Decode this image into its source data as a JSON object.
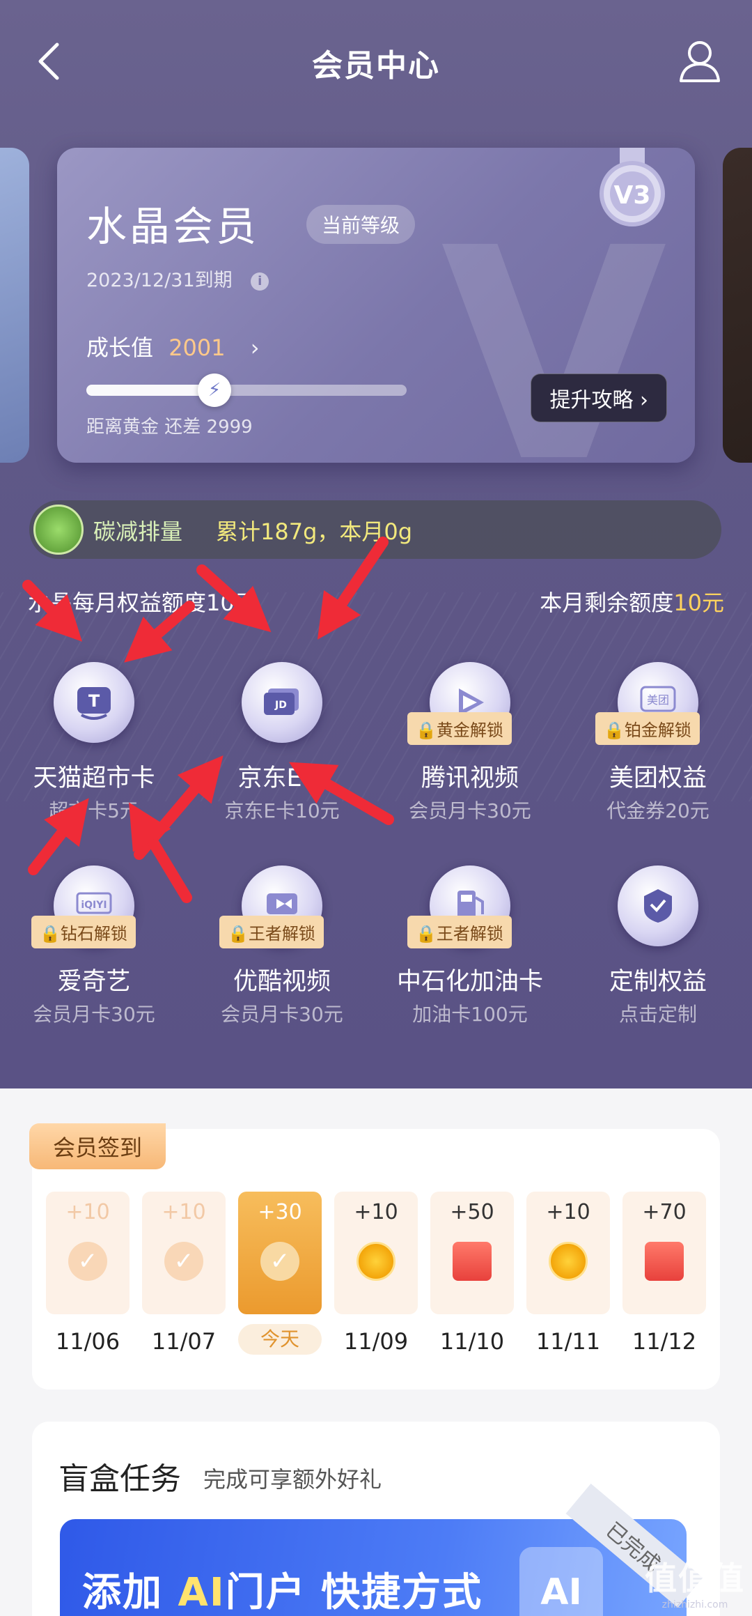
{
  "header": {
    "title": "会员中心"
  },
  "member_card": {
    "level_name": "水晶会员",
    "current_badge": "当前等级",
    "expire": "2023/12/31到期",
    "growth_label": "成长值",
    "growth_value": "2001",
    "growth_progress": 0.4,
    "distance_text": "距离黄金 还差 2999",
    "upgrade_button": "提升攻略",
    "medal_text": "V3"
  },
  "carbon": {
    "label": "碳减排量",
    "stat": "累计187g，本月0g"
  },
  "quota": {
    "left": "水晶每月权益额度10元",
    "right_label": "本月剩余额度",
    "right_value": "10元"
  },
  "benefits": [
    {
      "name": "天猫超市卡",
      "sub": "超市卡5元",
      "lock": "",
      "icon": "tmall-icon"
    },
    {
      "name": "京东E卡",
      "sub": "京东E卡10元",
      "lock": "",
      "icon": "jd-card-icon"
    },
    {
      "name": "腾讯视频",
      "sub": "会员月卡30元",
      "lock": "黄金解锁",
      "icon": "tencent-video-icon"
    },
    {
      "name": "美团权益",
      "sub": "代金券20元",
      "lock": "铂金解锁",
      "icon": "meituan-icon"
    },
    {
      "name": "爱奇艺",
      "sub": "会员月卡30元",
      "lock": "钻石解锁",
      "icon": "iqiyi-icon"
    },
    {
      "name": "优酷视频",
      "sub": "会员月卡30元",
      "lock": "王者解锁",
      "icon": "youku-icon"
    },
    {
      "name": "中石化加油卡",
      "sub": "加油卡100元",
      "lock": "王者解锁",
      "icon": "fuel-icon"
    },
    {
      "name": "定制权益",
      "sub": "点击定制",
      "lock": "",
      "icon": "custom-badge-icon"
    }
  ],
  "checkin": {
    "title": "会员签到",
    "today_label": "今天",
    "days": [
      {
        "points": "+10",
        "date": "11/06",
        "state": "past",
        "reward": "check"
      },
      {
        "points": "+10",
        "date": "11/07",
        "state": "past",
        "reward": "check"
      },
      {
        "points": "+30",
        "date": "",
        "state": "today",
        "reward": "check"
      },
      {
        "points": "+10",
        "date": "11/09",
        "state": "future",
        "reward": "coin"
      },
      {
        "points": "+50",
        "date": "11/10",
        "state": "future",
        "reward": "gift"
      },
      {
        "points": "+10",
        "date": "11/11",
        "state": "future",
        "reward": "coin"
      },
      {
        "points": "+70",
        "date": "11/12",
        "state": "future",
        "reward": "gift"
      }
    ]
  },
  "blind_box": {
    "title": "盲盒任务",
    "subtitle": "完成可享额外好礼",
    "banner_prefix": "添加",
    "banner_ai": "AI",
    "banner_suffix": "门户 快捷方式",
    "banner_done": "已完成",
    "banner_badge": "AI"
  },
  "watermark": {
    "logo": "值值值",
    "url": "zhizhizhi.com"
  }
}
